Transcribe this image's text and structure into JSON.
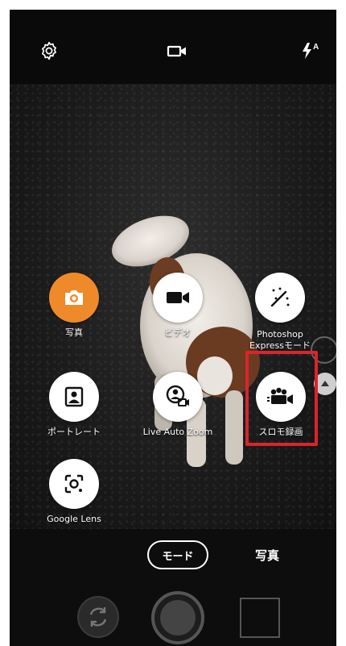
{
  "topbar": {
    "icons": [
      "gear-icon",
      "video-camera-icon",
      "flash-auto-icon"
    ],
    "flash_label": "A"
  },
  "modes": {
    "photo": "写真",
    "video": "ビデオ",
    "photoshop_line1": "Photoshop",
    "photoshop_line2": "Expressモード",
    "portrait": "ポートレート",
    "live_auto_zoom": "Live Auto Zoom",
    "slowmo": "スロモ録画",
    "google_lens": "Google Lens"
  },
  "bottom": {
    "mode_button": "モード",
    "current_mode": "写真"
  },
  "colors": {
    "accent_orange": "#ef8a2b",
    "highlight_red": "#d9252b"
  }
}
